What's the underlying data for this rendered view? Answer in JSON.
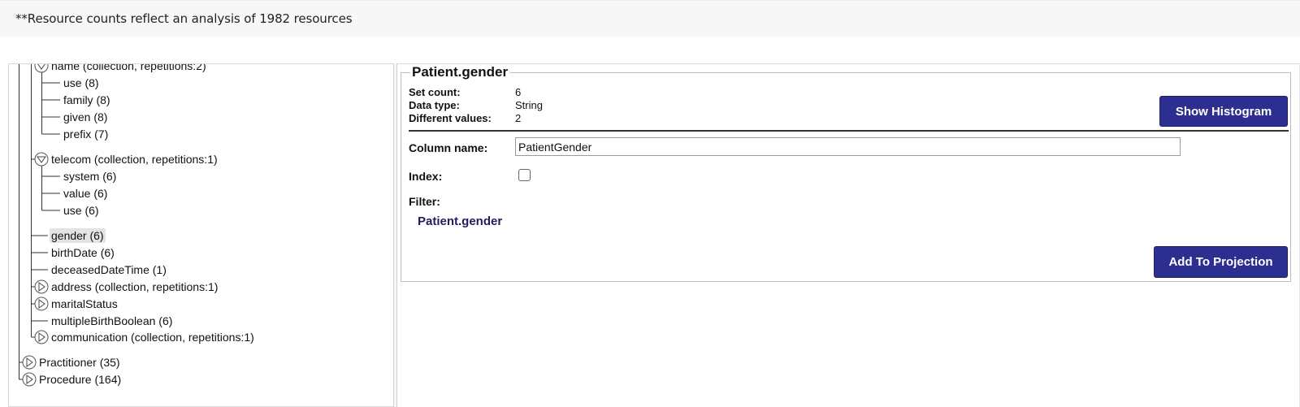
{
  "notice": "**Resource counts reflect an analysis of 1982 resources",
  "tree": {
    "name_node": "name (collection, repetitions:2)",
    "name_children": [
      "use (8)",
      "family (8)",
      "given (8)",
      "prefix (7)"
    ],
    "telecom_node": "telecom (collection, repetitions:1)",
    "telecom_children": [
      "system (6)",
      "value (6)",
      "use (6)"
    ],
    "patient_children": [
      "gender (6)",
      "birthDate (6)",
      "deceasedDateTime (1)",
      "address (collection, repetitions:1)",
      "maritalStatus",
      "multipleBirthBoolean (6)",
      "communication (collection, repetitions:1)"
    ],
    "resources": [
      "Practitioner (35)",
      "Procedure (164)"
    ]
  },
  "detail": {
    "title": "Patient.gender",
    "set_count_label": "Set count:",
    "set_count": "6",
    "data_type_label": "Data type:",
    "data_type": "String",
    "different_values_label": "Different values:",
    "different_values": "2",
    "show_histogram": "Show Histogram",
    "column_name_label": "Column name:",
    "column_name_value": "PatientGender",
    "index_label": "Index:",
    "filter_label": "Filter:",
    "filter_value": "Patient.gender",
    "add_to_projection": "Add To Projection"
  }
}
